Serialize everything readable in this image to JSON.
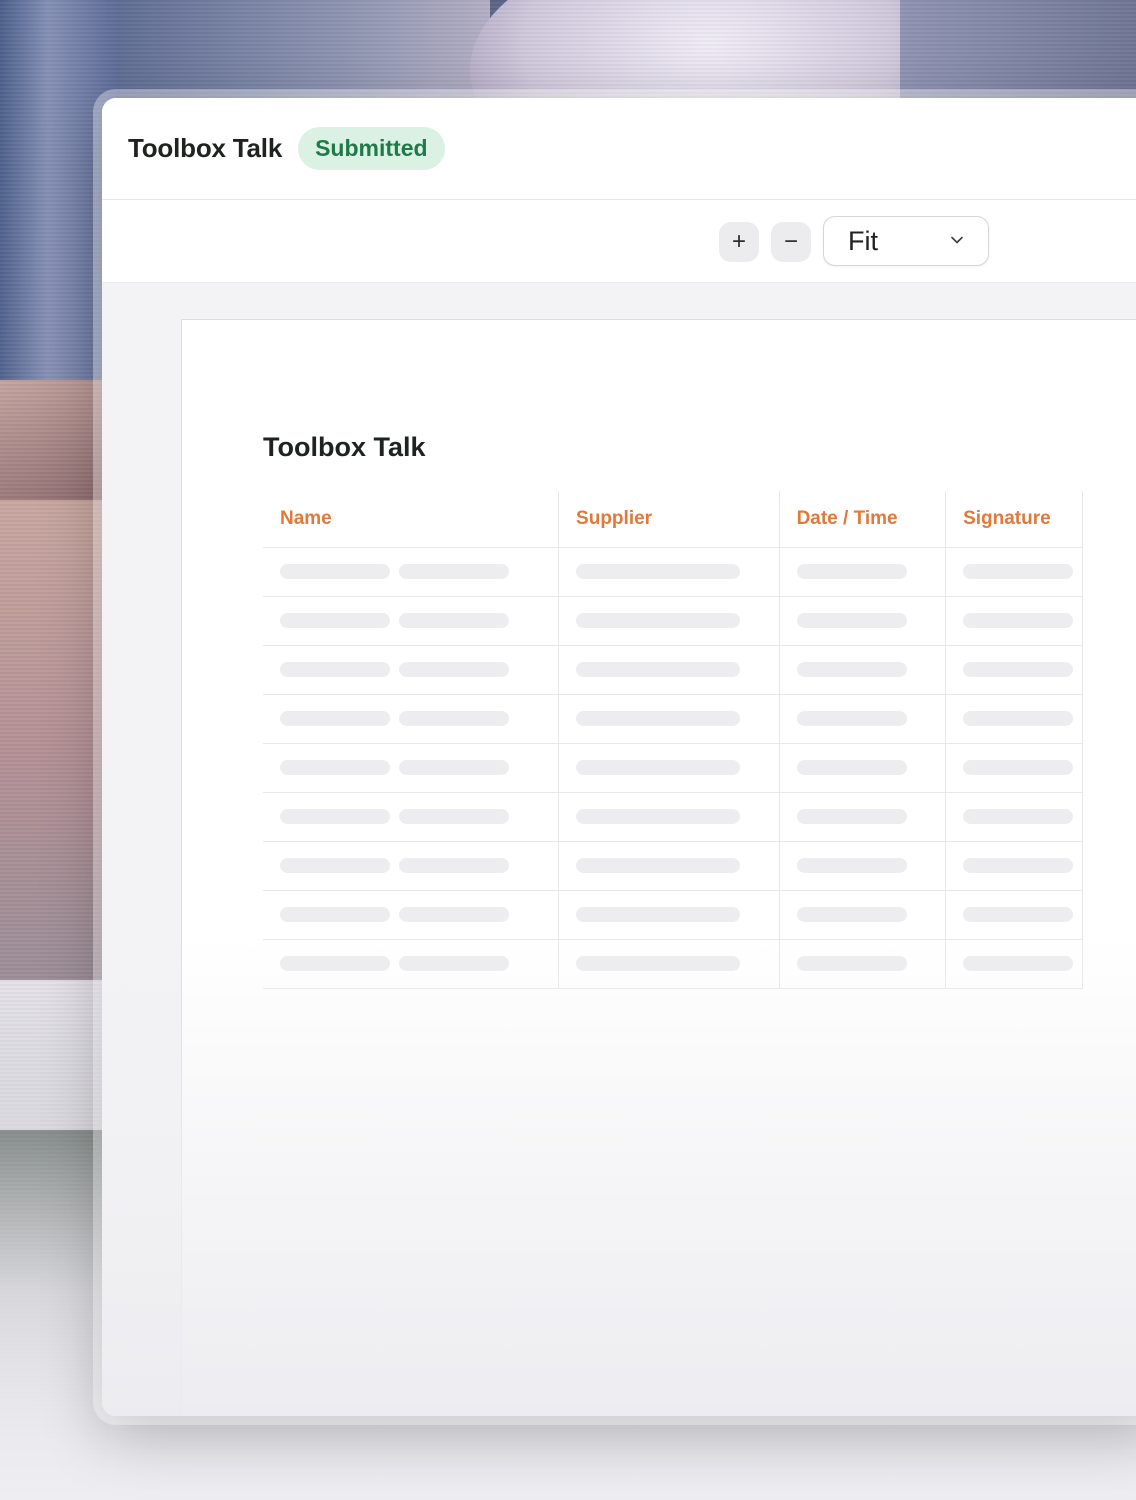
{
  "window": {
    "title": "Toolbox Talk",
    "status_badge": "Submitted",
    "status_color": "#1f7a4a"
  },
  "toolbar": {
    "zoom_in_label": "+",
    "zoom_out_label": "−",
    "zoom_value": "Fit",
    "zoom_icon": "chevron-down-icon"
  },
  "document": {
    "title": "Toolbox Talk",
    "accent_color": "#e2793a",
    "table": {
      "columns": [
        "Name",
        "Supplier",
        "Date / Time",
        "Signature"
      ],
      "placeholder_rows": 9
    }
  }
}
